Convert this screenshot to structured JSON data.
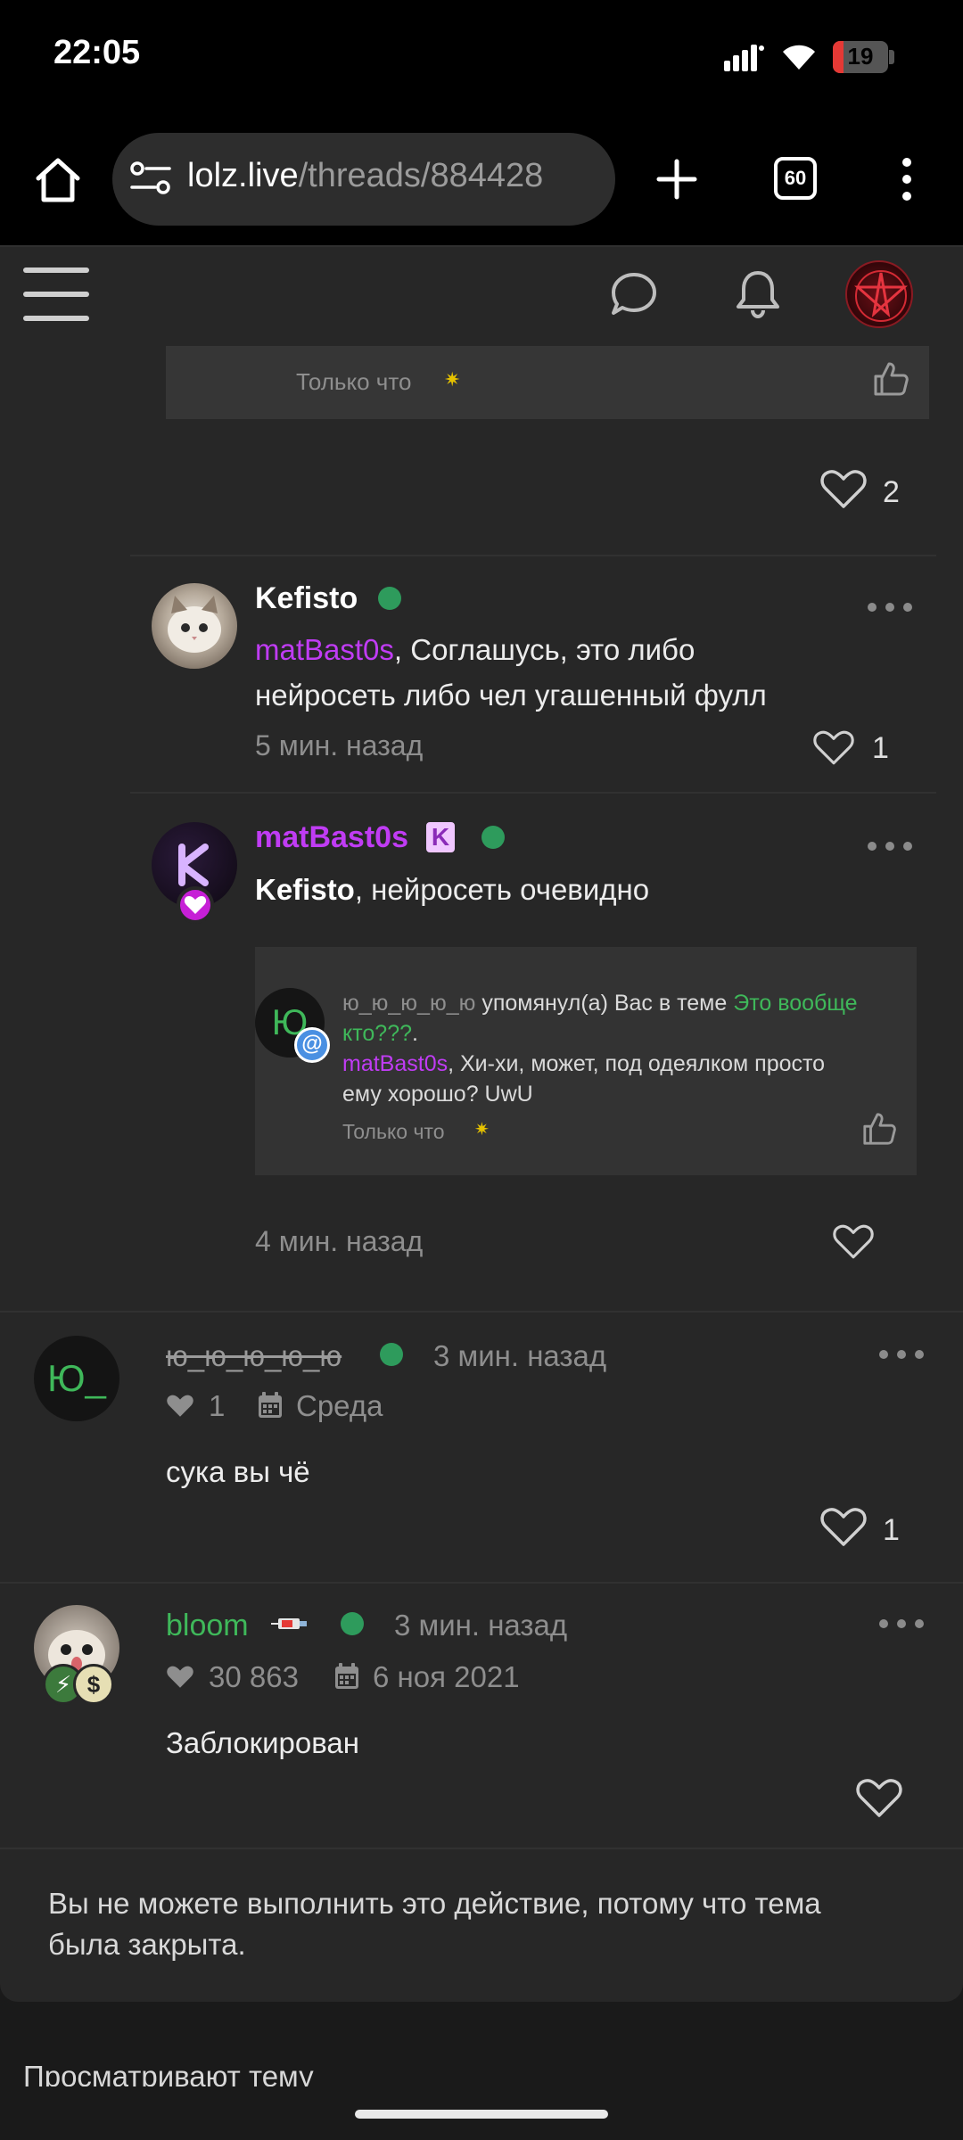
{
  "status": {
    "time": "22:05",
    "battery": "19",
    "battery_level": 0.19
  },
  "browser": {
    "url_host": "lolz.live",
    "url_path": "/threads/884428",
    "tab_count": "60"
  },
  "colors": {
    "accent_purple": "#c03cf4",
    "online": "#2e9b5c",
    "green_name": "#3fb85a",
    "background": "#272727"
  },
  "icons": [
    "home-icon",
    "site-settings-icon",
    "new-tab-icon",
    "tabs-icon",
    "more-menu-icon",
    "hamburger-menu-icon",
    "chat-icon",
    "bell-icon",
    "heart-icon",
    "like-icon",
    "calendar-icon"
  ],
  "top_quote": {
    "time": "Только что",
    "likes": "2"
  },
  "posts": [
    {
      "author": "Kefisto",
      "mention": "matBast0s",
      "text_line1": ", Соглашусь, это либо",
      "text_line2": "нейросеть либо чел угашенный фулл",
      "time": "5 мин. назад",
      "likes": "1"
    },
    {
      "author": "matBast0s",
      "mention": "Kefisto",
      "text": ", нейросеть очевидно",
      "time": "4 мин. назад",
      "avatar_letter": "K",
      "notification": {
        "user": "ю_ю_ю_ю_ю",
        "action": "упомянул(а) Вас в теме",
        "thread_line1": "Это вообще",
        "thread_line2": "кто???",
        "thread_period": ".",
        "mention": "matBast0s",
        "text": ", Хи-хи, может, под одеялком просто",
        "text_line2": "ему хорошо? UwU",
        "time": "Только что",
        "avatar_letter": "Ю"
      }
    }
  ],
  "threads": [
    {
      "author": "ю_ю_ю_ю_ю",
      "time": "3 мин. назад",
      "likes_total": "1",
      "joined": "Среда",
      "text": "сука вы чё",
      "likes": "1",
      "avatar_letters": "Ю_"
    },
    {
      "author": "bloom",
      "time": "3 мин. назад",
      "likes_total": "30 863",
      "joined": "6 ноя 2021",
      "text": "Заблокирован"
    }
  ],
  "closed_message_line1": "Вы не можете выполнить это действие, потому что тема",
  "closed_message_line2": "была закрыта.",
  "watching_label": "Просматривают тему"
}
